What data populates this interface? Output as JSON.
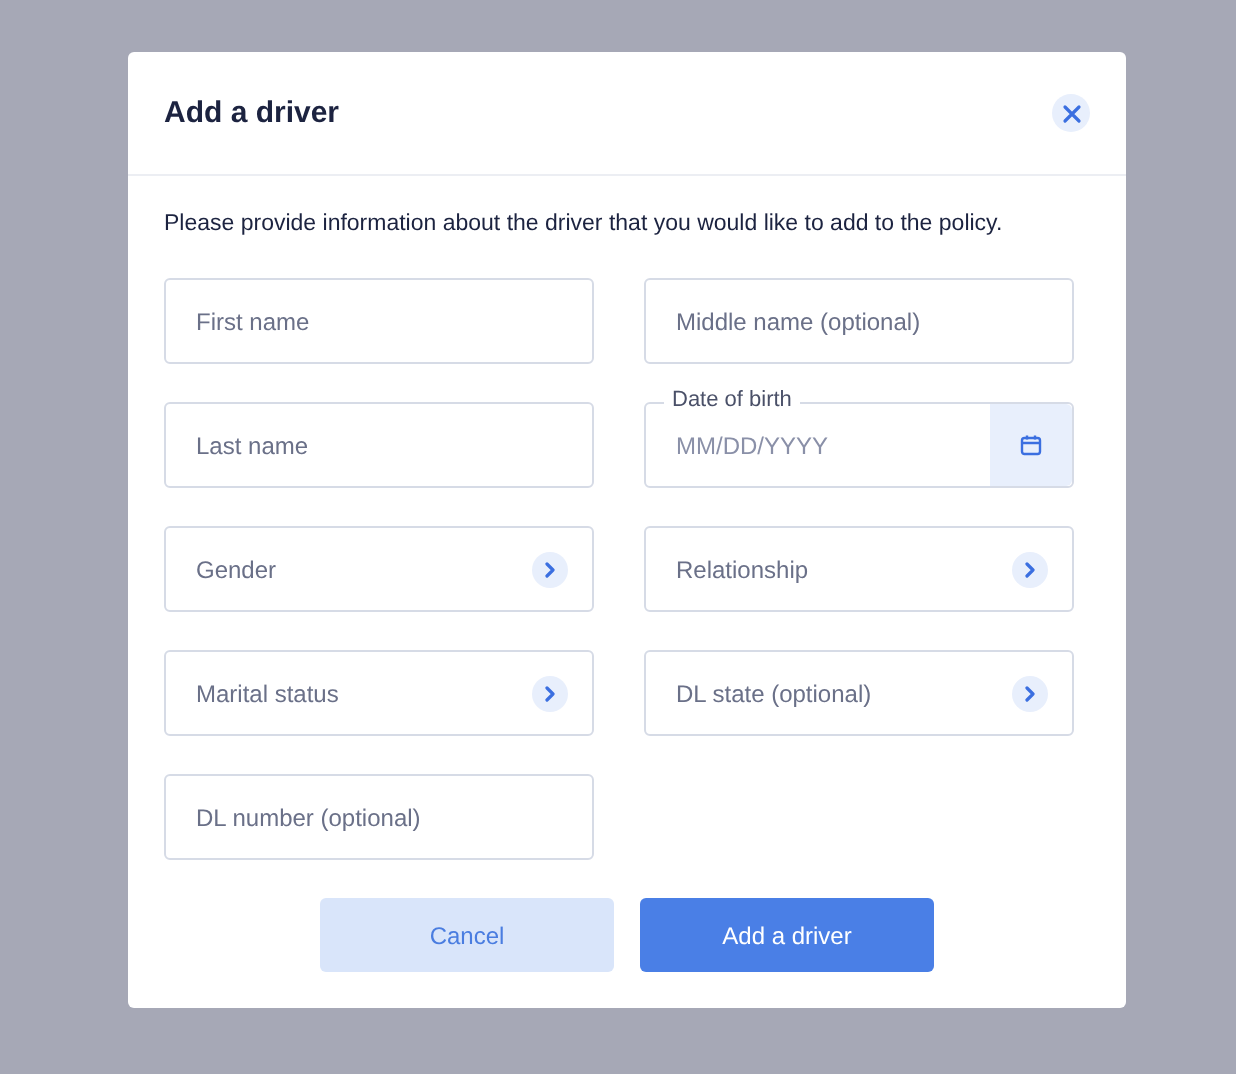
{
  "dialog": {
    "title": "Add a driver",
    "intro": "Please provide information about the driver that you would like to add to the policy.",
    "field_rows": [
      [
        {
          "kind": "text",
          "placeholder": "First name"
        },
        {
          "kind": "text",
          "placeholder": "Middle name (optional)"
        }
      ],
      [
        {
          "kind": "text",
          "placeholder": "Last name"
        },
        {
          "kind": "date",
          "label": "Date of birth",
          "placeholder": "MM/DD/YYYY"
        }
      ],
      [
        {
          "kind": "select",
          "placeholder": "Gender"
        },
        {
          "kind": "select",
          "placeholder": "Relationship"
        }
      ],
      [
        {
          "kind": "select",
          "placeholder": "Marital status"
        },
        {
          "kind": "select",
          "placeholder": "DL state (optional)"
        }
      ],
      [
        {
          "kind": "text",
          "placeholder": "DL number (optional)"
        }
      ]
    ],
    "buttons": [
      {
        "kind": "secondary",
        "label": "Cancel"
      },
      {
        "kind": "primary",
        "label": "Add a driver"
      }
    ]
  }
}
